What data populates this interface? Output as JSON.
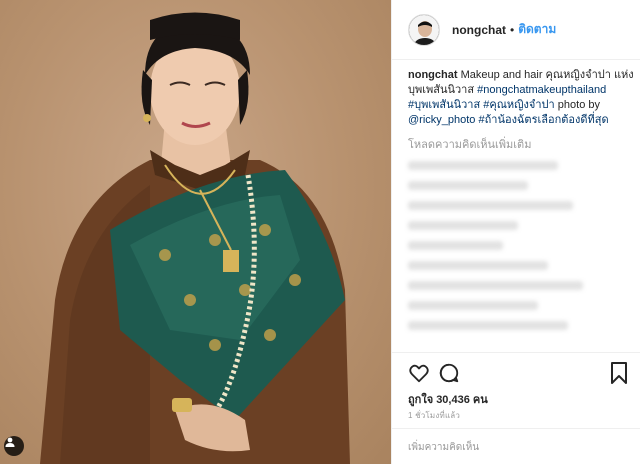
{
  "post": {
    "username": "nongchat",
    "follow_label": "ติดตาม",
    "separator": "•",
    "caption_user": "nongchat",
    "caption_text": "Makeup and hair คุณหญิงจำปา แห่ง บุพเพสันนิวาส",
    "hashtags_1": "#nongchatmakeupthailand #บุพเพสันนิวาส",
    "hashtags_2": "#คุณหญิงจำปา",
    "photo_credit_text": "photo by",
    "photo_credit_handle": "@ricky_photo",
    "hashtag_3": "#ถ้าน้องฉัตรเลือกต้องดีที่สุด",
    "load_more": "โหลดความคิดเห็นเพิ่มเติม",
    "likes": "ถูกใจ 30,436 คน",
    "timestamp": "1 ชั่วโมงที่แล้ว",
    "add_comment_placeholder": "เพิ่มความคิดเห็น"
  },
  "icons": {
    "like": "heart-icon",
    "comment": "comment-icon",
    "save": "bookmark-icon",
    "tag": "user-tag-icon"
  },
  "colors": {
    "link": "#3897f0",
    "hashtag": "#003569",
    "muted": "#999999",
    "backdrop": "#b8926f",
    "sash": "#1e5a4f",
    "blouse": "#6b4024"
  }
}
